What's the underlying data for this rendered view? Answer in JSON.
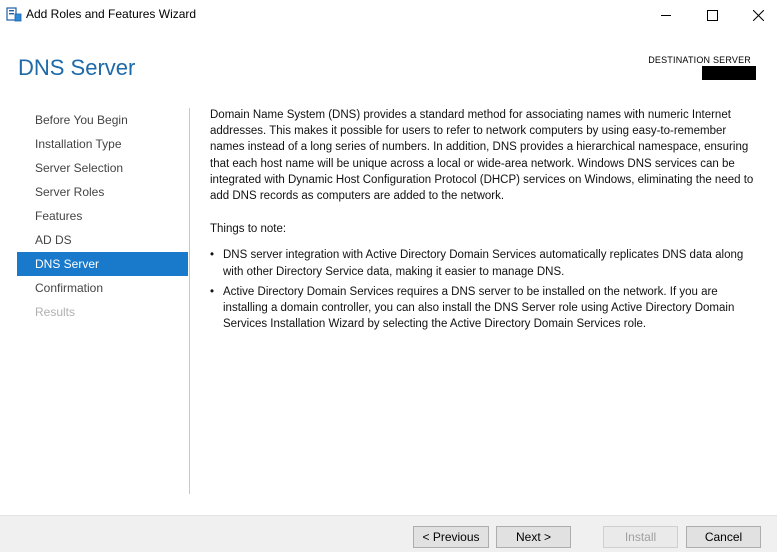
{
  "window": {
    "title": "Add Roles and Features Wizard"
  },
  "page": {
    "heading": "DNS Server",
    "destination_label": "DESTINATION SERVER"
  },
  "nav": {
    "items": [
      {
        "label": "Before You Begin",
        "state": "normal"
      },
      {
        "label": "Installation Type",
        "state": "normal"
      },
      {
        "label": "Server Selection",
        "state": "normal"
      },
      {
        "label": "Server Roles",
        "state": "normal"
      },
      {
        "label": "Features",
        "state": "normal"
      },
      {
        "label": "AD DS",
        "state": "normal"
      },
      {
        "label": "DNS Server",
        "state": "active"
      },
      {
        "label": "Confirmation",
        "state": "normal"
      },
      {
        "label": "Results",
        "state": "disabled"
      }
    ]
  },
  "content": {
    "intro": "Domain Name System (DNS) provides a standard method for associating names with numeric Internet addresses. This makes it possible for users to refer to network computers by using easy-to-remember names instead of a long series of numbers. In addition, DNS provides a hierarchical namespace, ensuring that each host name will be unique across a local or wide-area network. Windows DNS services can be integrated with Dynamic Host Configuration Protocol (DHCP) services on Windows, eliminating the need to add DNS records as computers are added to the network.",
    "notes_title": "Things to note:",
    "notes": [
      "DNS server integration with Active Directory Domain Services automatically replicates DNS data along with other Directory Service data, making it easier to manage DNS.",
      "Active Directory Domain Services requires a DNS server to be installed on the network. If you are installing a domain controller, you can also install the DNS Server role using Active Directory Domain Services Installation Wizard by selecting the Active Directory Domain Services role."
    ]
  },
  "buttons": {
    "previous": "< Previous",
    "next": "Next >",
    "install": "Install",
    "cancel": "Cancel"
  },
  "colors": {
    "accent": "#1979ca",
    "heading": "#1e6aa8"
  }
}
